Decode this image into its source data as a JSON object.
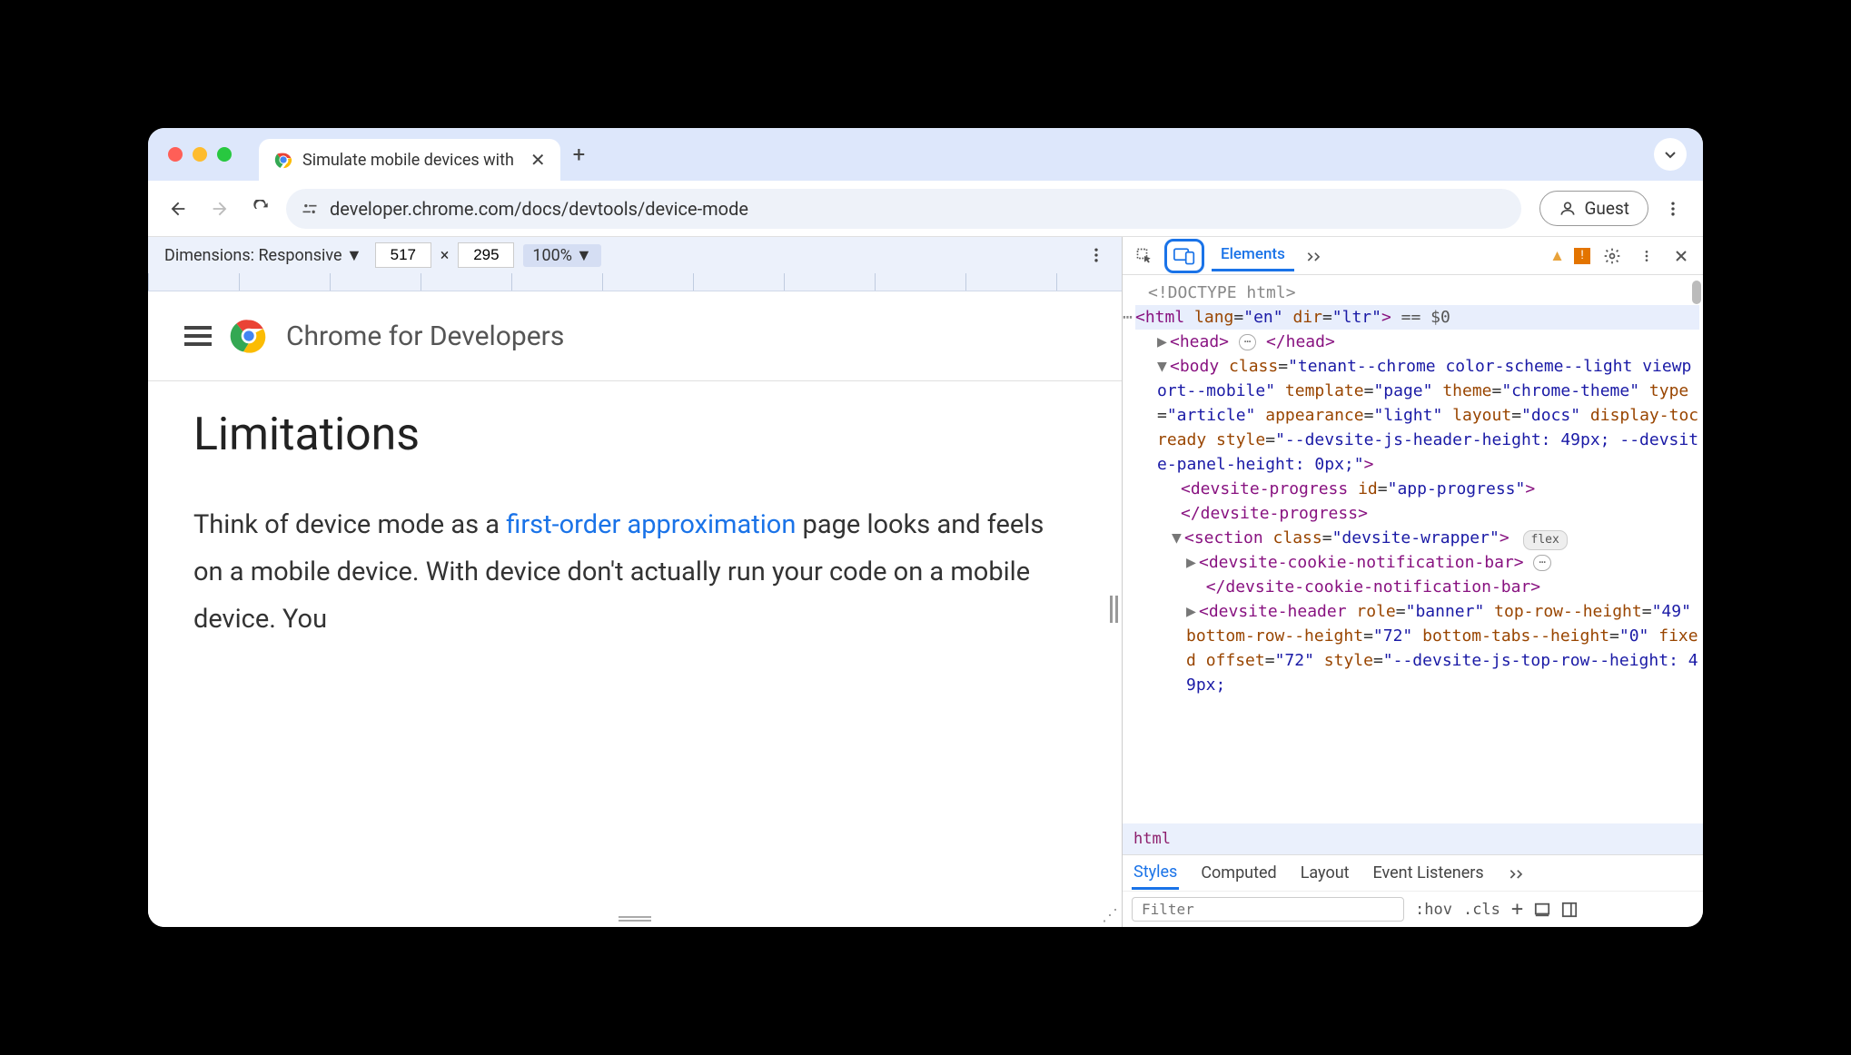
{
  "browser": {
    "tab_title": "Simulate mobile devices with",
    "url": "developer.chrome.com/docs/devtools/device-mode",
    "guest_label": "Guest"
  },
  "device_bar": {
    "dimensions_label": "Dimensions: Responsive",
    "width": "517",
    "times": "×",
    "height": "295",
    "zoom": "100%"
  },
  "simulated_page": {
    "brand": "Chrome for Developers",
    "heading": "Limitations",
    "body_pre": "Think of device mode as a ",
    "body_link": "first-order approximation",
    "body_post": " page looks and feels on a mobile device. With device don't actually run your code on a mobile device. You "
  },
  "devtools": {
    "tab_elements": "Elements",
    "dom": {
      "doctype": "<!DOCTYPE html>",
      "html_open": "<html lang=\"en\" dir=\"ltr\">",
      "html_suffix": " == $0",
      "head": "<head> ⋯ </head>",
      "body_open": "<body class=\"tenant--chrome color-scheme--light viewport--mobile\" template=\"page\" theme=\"chrome-theme\" type=\"article\" appearance=\"light\" layout=\"docs\" display-toc ready style=\"--devsite-js-header-height: 49px; --devsite-panel-height: 0px;\">",
      "progress": "<devsite-progress id=\"app-progress\"></devsite-progress>",
      "section_open": "<section class=\"devsite-wrapper\">",
      "cookie": "<devsite-cookie-notification-bar> ⋯ </devsite-cookie-notification-bar>",
      "header_open": "<devsite-header role=\"banner\" top-row--height=\"49\" bottom-row--height=\"72\" bottom-tabs--height=\"0\" fixed offset=\"72\" style=\"--devsite-js-top-row--height: 49px;"
    },
    "breadcrumb": "html",
    "styles_tabs": {
      "styles": "Styles",
      "computed": "Computed",
      "layout": "Layout",
      "listeners": "Event Listeners"
    },
    "filter_placeholder": "Filter",
    "hov": ":hov",
    "cls": ".cls"
  }
}
